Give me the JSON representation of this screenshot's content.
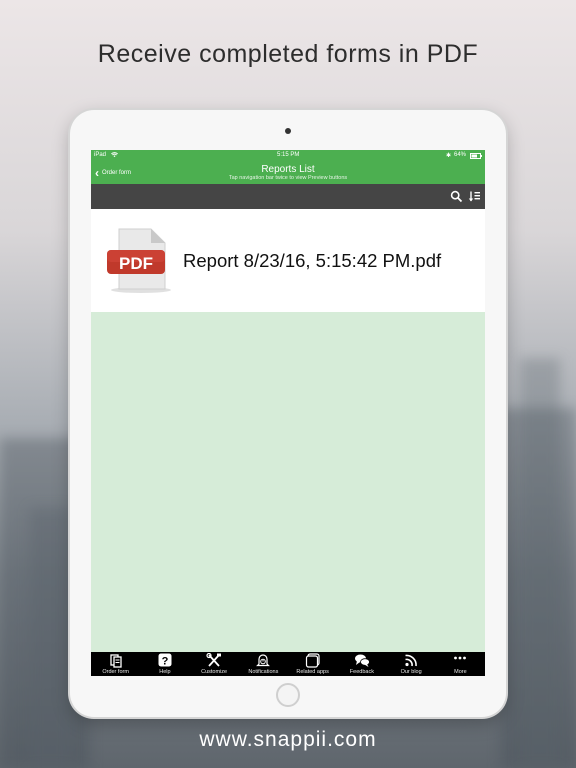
{
  "headline": "Receive completed forms in PDF",
  "footer_url": "www.snappii.com",
  "status_bar": {
    "carrier": "iPad",
    "time": "5:15 PM",
    "battery": "64%"
  },
  "nav": {
    "back_label": "Order form",
    "title": "Reports List",
    "subtitle": "Tap navigation bar twice to view Preview buttons"
  },
  "toolbar": {
    "icons": [
      "search-icon",
      "sort-icon"
    ]
  },
  "reports": [
    {
      "file_name": "Report 8/23/16, 5:15:42 PM.pdf",
      "badge": "PDF"
    }
  ],
  "tabs": [
    {
      "label": "Order form",
      "icon": "form-icon"
    },
    {
      "label": "Help",
      "icon": "help-icon"
    },
    {
      "label": "Customize",
      "icon": "tools-icon"
    },
    {
      "label": "Notifications",
      "icon": "bell-icon"
    },
    {
      "label": "Related apps",
      "icon": "apps-icon"
    },
    {
      "label": "Feedback",
      "icon": "chat-icon"
    },
    {
      "label": "Our blog",
      "icon": "rss-icon"
    },
    {
      "label": "More",
      "icon": "more-icon"
    }
  ],
  "colors": {
    "brand_green": "#4caf50",
    "toolbar_dark": "#454545",
    "content_bg": "#d6ecd8",
    "pdf_red": "#c0392b"
  }
}
